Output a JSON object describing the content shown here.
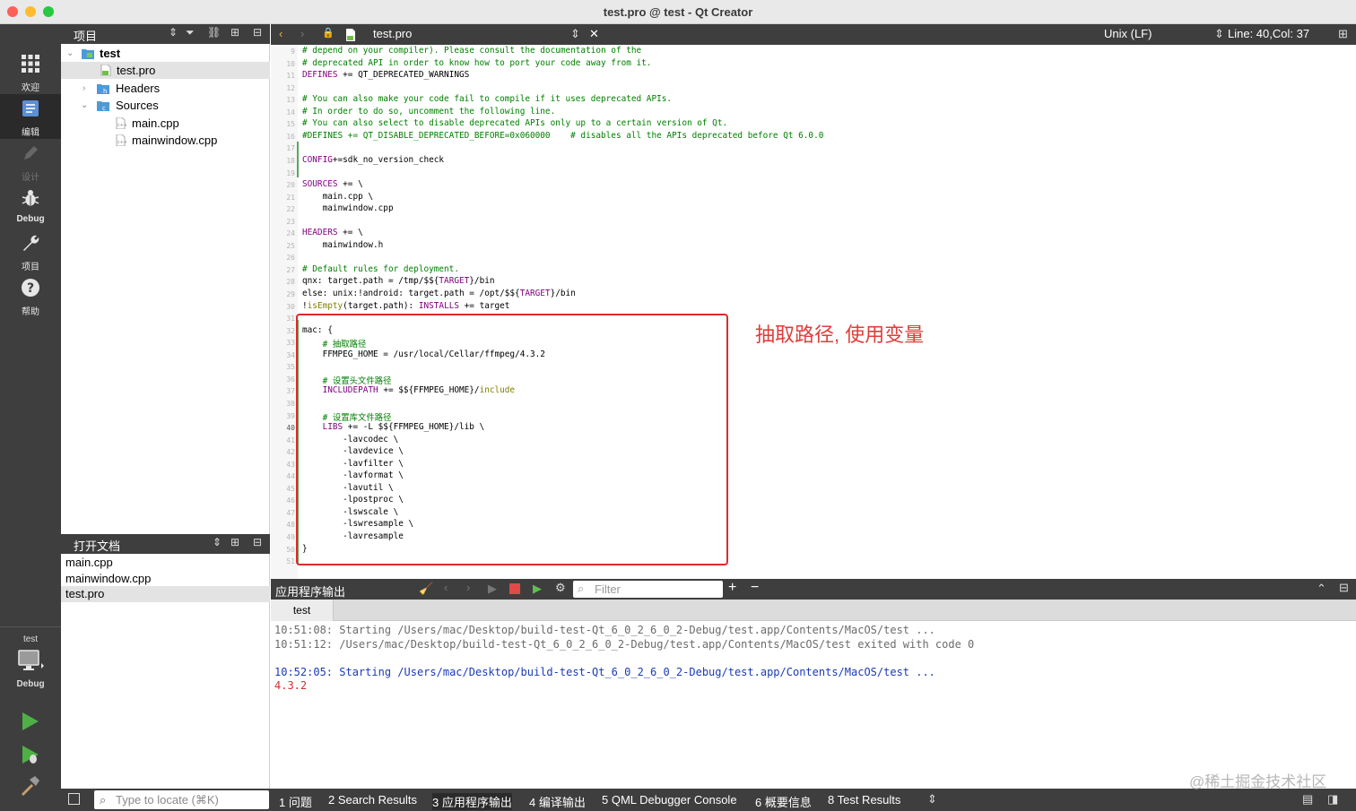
{
  "window": {
    "title": "test.pro @ test - Qt Creator"
  },
  "modes": [
    {
      "label": "欢迎",
      "icon": "grid-icon"
    },
    {
      "label": "编辑",
      "icon": "edit-icon"
    },
    {
      "label": "设计",
      "icon": "pen-icon"
    },
    {
      "label": "Debug",
      "icon": "bug-icon"
    },
    {
      "label": "项目",
      "icon": "wrench-icon"
    },
    {
      "label": "帮助",
      "icon": "help-icon"
    }
  ],
  "kit": {
    "name": "test",
    "mode": "Debug"
  },
  "project_pane": {
    "title": "项目",
    "tree": [
      {
        "label": "test"
      },
      {
        "label": "test.pro"
      },
      {
        "label": "Headers"
      },
      {
        "label": "Sources"
      },
      {
        "label": "main.cpp"
      },
      {
        "label": "mainwindow.cpp"
      }
    ]
  },
  "open_documents": {
    "title": "打开文档",
    "items": [
      "main.cpp",
      "mainwindow.cpp",
      "test.pro"
    ]
  },
  "editor_toolbar": {
    "file": "test.pro",
    "line_ending": "Unix (LF)",
    "position": "Line: 40,Col: 37"
  },
  "code": {
    "first_line": 9,
    "current_line": 40,
    "lines": [
      [
        [
          "comment",
          "# depend on your compiler). Please consult the documentation of the"
        ]
      ],
      [
        [
          "comment",
          "# deprecated API in order to know how to port your code away from it."
        ]
      ],
      [
        [
          "var",
          "DEFINES"
        ],
        [
          "plain",
          " += QT_DEPRECATED_WARNINGS"
        ]
      ],
      [],
      [
        [
          "comment",
          "# You can also make your code fail to compile if it uses deprecated APIs."
        ]
      ],
      [
        [
          "comment",
          "# In order to do so, uncomment the following line."
        ]
      ],
      [
        [
          "comment",
          "# You can also select to disable deprecated APIs only up to a certain version of Qt."
        ]
      ],
      [
        [
          "comment",
          "#DEFINES += QT_DISABLE_DEPRECATED_BEFORE=0x060000    # disables all the APIs deprecated before Qt 6.0.0"
        ]
      ],
      [],
      [
        [
          "var",
          "CONFIG"
        ],
        [
          "plain",
          "+=sdk_no_version_check"
        ]
      ],
      [],
      [
        [
          "var",
          "SOURCES"
        ],
        [
          "plain",
          " += \\"
        ]
      ],
      [
        [
          "plain",
          "    main.cpp \\"
        ]
      ],
      [
        [
          "plain",
          "    mainwindow.cpp"
        ]
      ],
      [],
      [
        [
          "var",
          "HEADERS"
        ],
        [
          "plain",
          " += \\"
        ]
      ],
      [
        [
          "plain",
          "    mainwindow.h"
        ]
      ],
      [],
      [
        [
          "comment",
          "# Default rules for deployment."
        ]
      ],
      [
        [
          "plain",
          "qnx: target.path = /tmp/$${"
        ],
        [
          "var",
          "TARGET"
        ],
        [
          "plain",
          "}/bin"
        ]
      ],
      [
        [
          "plain",
          "else: unix:!android: target.path = /opt/$${"
        ],
        [
          "var",
          "TARGET"
        ],
        [
          "plain",
          "}/bin"
        ]
      ],
      [
        [
          "plain",
          "!"
        ],
        [
          "func",
          "isEmpty"
        ],
        [
          "plain",
          "(target.path): "
        ],
        [
          "var",
          "INSTALLS"
        ],
        [
          "plain",
          " += target"
        ]
      ],
      [],
      [
        [
          "plain",
          "mac: {"
        ]
      ],
      [
        [
          "comment",
          "    # 抽取路径"
        ]
      ],
      [
        [
          "plain",
          "    FFMPEG_HOME = /usr/local/Cellar/ffmpeg/4.3.2"
        ]
      ],
      [],
      [
        [
          "comment",
          "    # 设置头文件路径"
        ]
      ],
      [
        [
          "plain",
          "    "
        ],
        [
          "var",
          "INCLUDEPATH"
        ],
        [
          "plain",
          " += $${FFMPEG_HOME}/"
        ],
        [
          "func",
          "include"
        ]
      ],
      [],
      [
        [
          "comment",
          "    # 设置库文件路径"
        ]
      ],
      [
        [
          "plain",
          "    "
        ],
        [
          "var",
          "LIBS"
        ],
        [
          "plain",
          " += -L $${FFMPEG_HOME}/lib \\"
        ]
      ],
      [
        [
          "plain",
          "        -lavcodec \\"
        ]
      ],
      [
        [
          "plain",
          "        -lavdevice \\"
        ]
      ],
      [
        [
          "plain",
          "        -lavfilter \\"
        ]
      ],
      [
        [
          "plain",
          "        -lavformat \\"
        ]
      ],
      [
        [
          "plain",
          "        -lavutil \\"
        ]
      ],
      [
        [
          "plain",
          "        -lpostproc \\"
        ]
      ],
      [
        [
          "plain",
          "        -lswscale \\"
        ]
      ],
      [
        [
          "plain",
          "        -lswresample \\"
        ]
      ],
      [
        [
          "plain",
          "        -lavresample"
        ]
      ],
      [
        [
          "plain",
          "}"
        ]
      ],
      []
    ]
  },
  "annotation": "抽取路径, 使用变量",
  "output_pane": {
    "title": "应用程序输出",
    "filter_placeholder": "Filter",
    "tab": "test",
    "lines": [
      {
        "text": "10:51:08: Starting /Users/mac/Desktop/build-test-Qt_6_0_2_6_0_2-Debug/test.app/Contents/MacOS/test ...",
        "style": "grey"
      },
      {
        "text": "10:51:12: /Users/mac/Desktop/build-test-Qt_6_0_2_6_0_2-Debug/test.app/Contents/MacOS/test exited with code 0",
        "style": "grey"
      },
      {
        "text": "",
        "style": "grey"
      },
      {
        "text": "10:52:05: Starting /Users/mac/Desktop/build-test-Qt_6_0_2_6_0_2-Debug/test.app/Contents/MacOS/test ...",
        "style": "blue"
      },
      {
        "text": "4.3.2",
        "style": "red"
      }
    ]
  },
  "statusbar": {
    "locator_placeholder": "Type to locate (⌘K)",
    "tabs": [
      "1  问题",
      "2  Search Results",
      "3  应用程序输出",
      "4  编译输出",
      "5  QML Debugger Console",
      "6  概要信息",
      "8  Test Results"
    ],
    "active_tab": 2
  },
  "watermark": "@稀土掘金技术社区",
  "colors": {
    "annotation": "#e03c3a",
    "highlight_border": "#e0292b",
    "dark_bar": "#3e3e3e"
  }
}
